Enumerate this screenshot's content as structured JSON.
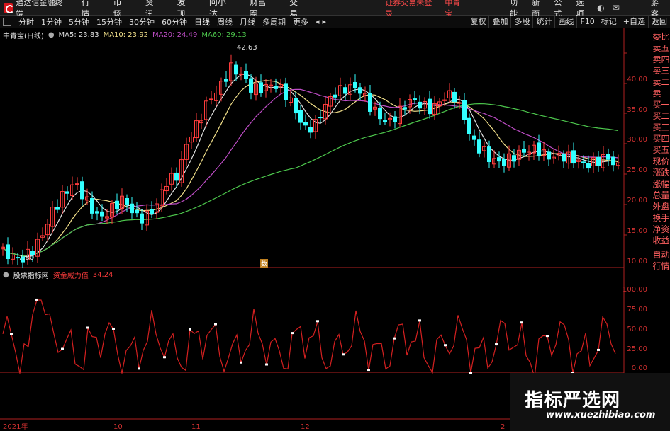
{
  "menubar": {
    "app_title": "通达信金融终端",
    "items": [
      "行情",
      "市场",
      "资讯",
      "发现",
      "问小达",
      "财富圈",
      "交易"
    ],
    "login_warning": "证券交易未登录",
    "security_name": "中青宝",
    "right_items": [
      "功能",
      "新面",
      "公式",
      "选项"
    ],
    "guest": "游客"
  },
  "toolbar": {
    "periods": [
      "分时",
      "1分钟",
      "5分钟",
      "15分钟",
      "30分钟",
      "60分钟",
      "日线",
      "周线",
      "月线",
      "多周期",
      "更多"
    ],
    "active_period": "日线",
    "right_buttons": [
      "复权",
      "叠加",
      "多股",
      "统计",
      "画线",
      "F10",
      "标记",
      "+自选",
      "返回"
    ]
  },
  "side_panel": {
    "items": [
      "委比",
      "卖五",
      "卖四",
      "卖三",
      "卖二",
      "卖一",
      "买一",
      "买二",
      "买三",
      "买四",
      "买五",
      "现价",
      "涨跌",
      "涨幅",
      "总量",
      "外盘",
      "换手",
      "净资",
      "收益",
      "自动",
      "行情"
    ]
  },
  "main_chart": {
    "title": "中青宝(日线)",
    "ma": [
      {
        "label": "MA5: 23.83",
        "color": "#e0e0e0"
      },
      {
        "label": "MA10: 23.92",
        "color": "#f2e08a"
      },
      {
        "label": "MA20: 24.49",
        "color": "#c04ec8"
      },
      {
        "label": "MA60: 29.13",
        "color": "#4dc84d"
      }
    ],
    "high_label": "42.63",
    "low_label": "7.80",
    "price_ticks": [
      "40.00",
      "35.00",
      "30.00",
      "25.00",
      "20.00",
      "15.00",
      "10.00"
    ],
    "event_marker": "数"
  },
  "sub_chart": {
    "title": "股票指标网",
    "indicator_label": "资金威力值",
    "indicator_value": "34.24",
    "ticks": [
      "100.00",
      "75.00",
      "50.00",
      "25.00",
      "0.00"
    ]
  },
  "time_axis": {
    "labels": [
      "2021年",
      "10",
      "11",
      "12",
      "2"
    ]
  },
  "colors": {
    "up": "#ff3c3c",
    "down": "#33ffff",
    "ma5": "#e0e0e0",
    "ma10": "#f2e08a",
    "ma20": "#c04ec8",
    "ma60": "#4dc84d",
    "indicator": "#d42020"
  },
  "watermark": {
    "text_cn": "指标严选网",
    "url": "www.xuezhibiao.com"
  }
}
